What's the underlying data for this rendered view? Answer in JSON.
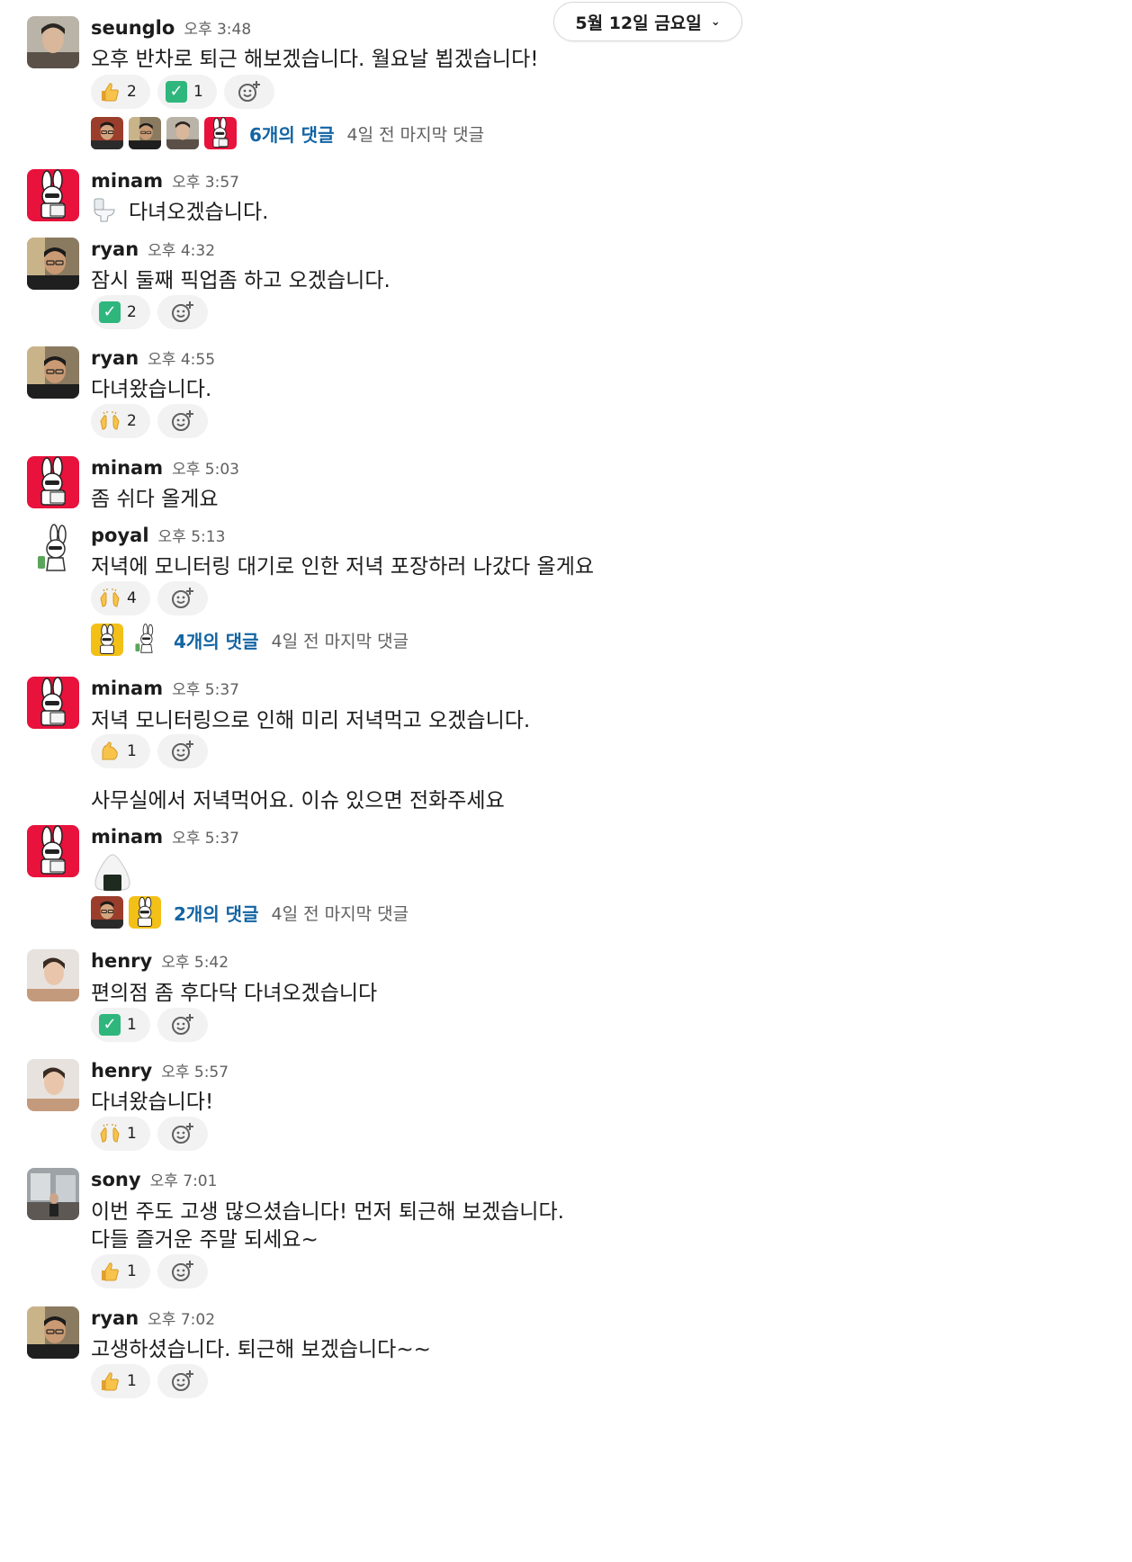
{
  "date_divider": {
    "label": "5월 12일 금요일",
    "chevron_icon": "chevron-down-icon"
  },
  "messages": [
    {
      "user": "seunglo",
      "time": "오후 3:48",
      "text": "오후 반차로 퇴근 해보겠습니다. 월요날 뵙겠습니다!",
      "reactions": [
        {
          "emoji": "thumbs-up",
          "count": "2"
        },
        {
          "emoji": "check-mark",
          "count": "1"
        }
      ],
      "thread": {
        "count": "6개의 댓글",
        "last": "4일 전 마지막 댓글"
      }
    },
    {
      "user": "minam",
      "time": "오후 3:57",
      "text": "다녀오겠습니다.",
      "leading_emoji": "toilet"
    },
    {
      "user": "ryan",
      "time": "오후 4:32",
      "text": "잠시 둘째 픽업좀 하고 오겠습니다.",
      "reactions": [
        {
          "emoji": "check-mark",
          "count": "2"
        }
      ]
    },
    {
      "user": "ryan",
      "time": "오후 4:55",
      "text": "다녀왔습니다.",
      "reactions": [
        {
          "emoji": "raising-hands",
          "count": "2"
        }
      ]
    },
    {
      "user": "minam",
      "time": "오후 5:03",
      "text": "좀 쉬다 올게요"
    },
    {
      "user": "poyal",
      "time": "오후 5:13",
      "text": "저녁에 모니터링 대기로 인한 저녁 포장하러 나갔다 올게요",
      "reactions": [
        {
          "emoji": "raising-hands",
          "count": "4"
        }
      ],
      "thread": {
        "count": "4개의 댓글",
        "last": "4일 전 마지막 댓글"
      }
    },
    {
      "user": "minam",
      "time": "오후 5:37",
      "text": "저녁 모니터링으로 인해 미리 저녁먹고 오겠습니다.",
      "reactions": [
        {
          "emoji": "flexed-biceps",
          "count": "1"
        }
      ],
      "followup": "사무실에서 저녁먹어요. 이슈 있으면 전화주세요"
    },
    {
      "user": "minam",
      "time": "오후 5:37",
      "text": "",
      "emoji_only": "rice-ball",
      "thread": {
        "count": "2개의 댓글",
        "last": "4일 전 마지막 댓글"
      }
    },
    {
      "user": "henry",
      "time": "오후 5:42",
      "text": "편의점 좀 후다닥 다녀오겠습니다",
      "reactions": [
        {
          "emoji": "check-mark",
          "count": "1"
        }
      ]
    },
    {
      "user": "henry",
      "time": "오후 5:57",
      "text": "다녀왔습니다!",
      "reactions": [
        {
          "emoji": "raising-hands",
          "count": "1"
        }
      ]
    },
    {
      "user": "sony",
      "time": "오후 7:01",
      "text": "이번 주도 고생 많으셨습니다! 먼저 퇴근해 보겠습니다.",
      "text2": " 다들 즐거운 주말 되세요~",
      "reactions": [
        {
          "emoji": "thumbs-up",
          "count": "1"
        }
      ]
    },
    {
      "user": "ryan",
      "time": "오후 7:02",
      "text": "고생하셨습니다. 퇴근해 보겠습니다~~",
      "reactions": [
        {
          "emoji": "thumbs-up",
          "count": "1"
        }
      ]
    }
  ],
  "colors": {
    "link": "#1264a3",
    "muted": "#616061",
    "reaction_bg": "#f2f2f2",
    "minam_avatar_bg": "#e8123c"
  }
}
